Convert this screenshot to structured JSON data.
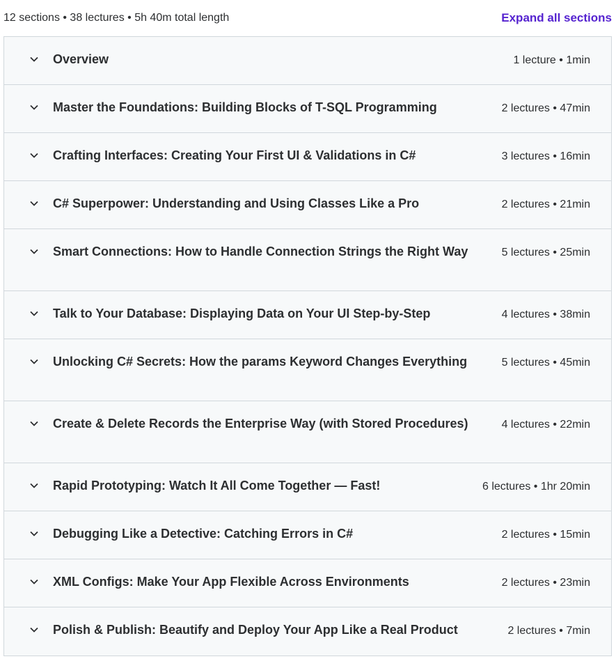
{
  "header": {
    "summary": "12 sections • 38 lectures • 5h 40m total length",
    "expand_all_label": "Expand all sections"
  },
  "colors": {
    "accent": "#5624d0",
    "section_bg": "#f7f9fa",
    "border": "#d1d7dc",
    "text": "#2d2f31"
  },
  "sections": [
    {
      "title": "Overview",
      "meta": "1 lecture • 1min",
      "icon": "chevron-down-icon"
    },
    {
      "title": "Master the Foundations: Building Blocks of T-SQL Programming",
      "meta": "2 lectures • 47min",
      "icon": "chevron-down-icon"
    },
    {
      "title": "Crafting Interfaces: Creating Your First UI & Validations in C#",
      "meta": "3 lectures • 16min",
      "icon": "chevron-down-icon"
    },
    {
      "title": "C# Superpower: Understanding and Using Classes Like a Pro",
      "meta": "2 lectures • 21min",
      "icon": "chevron-down-icon"
    },
    {
      "title": "Smart Connections: How to Handle Connection Strings the Right Way",
      "meta": "5 lectures • 25min",
      "icon": "chevron-down-icon"
    },
    {
      "title": "Talk to Your Database: Displaying Data on Your UI Step-by-Step",
      "meta": "4 lectures • 38min",
      "icon": "chevron-down-icon"
    },
    {
      "title": "Unlocking C# Secrets: How the params Keyword Changes Everything",
      "meta": "5 lectures • 45min",
      "icon": "chevron-down-icon"
    },
    {
      "title": "Create & Delete Records the Enterprise Way (with Stored Procedures)",
      "meta": "4 lectures • 22min",
      "icon": "chevron-down-icon"
    },
    {
      "title": "Rapid Prototyping: Watch It All Come Together — Fast!",
      "meta": "6 lectures • 1hr 20min",
      "icon": "chevron-down-icon"
    },
    {
      "title": "Debugging Like a Detective: Catching Errors in C#",
      "meta": "2 lectures • 15min",
      "icon": "chevron-down-icon"
    },
    {
      "title": "XML Configs: Make Your App Flexible Across Environments",
      "meta": "2 lectures • 23min",
      "icon": "chevron-down-icon"
    },
    {
      "title": "Polish & Publish: Beautify and Deploy Your App Like a Real Product",
      "meta": "2 lectures • 7min",
      "icon": "chevron-down-icon"
    }
  ]
}
